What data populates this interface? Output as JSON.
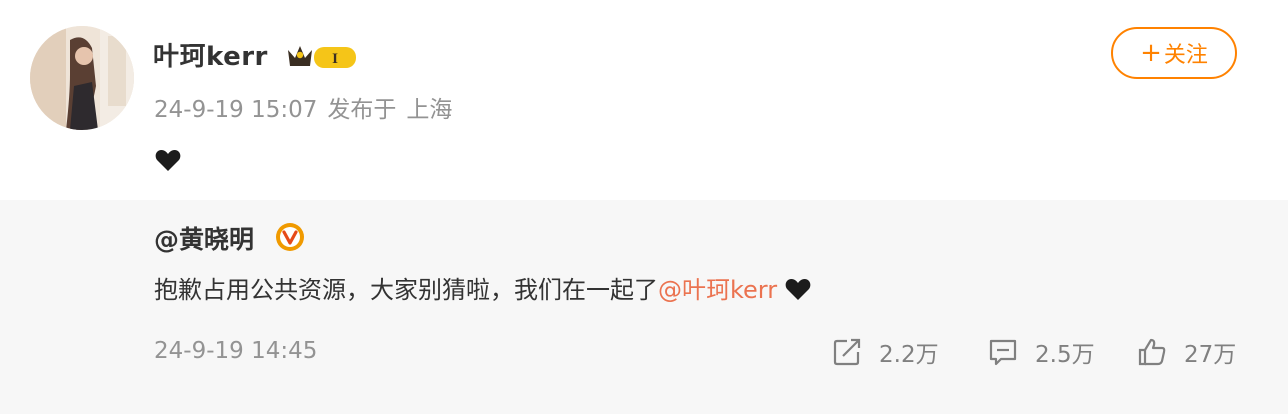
{
  "post": {
    "username": "叶珂kerr",
    "timestamp": "24-9-19 15:07",
    "location_prefix": "发布于",
    "location": "上海",
    "content_icon": "heart-icon",
    "follow_label": "关注",
    "follow_plus": "+",
    "badge_text": "I",
    "badge_color": "#f5c518"
  },
  "repost": {
    "mention_name": "@黄晓明",
    "verified_badge_color": "#f09a00",
    "text": "抱歉占用公共资源，大家别猜啦，我们在一起了",
    "mention_link": "@叶珂kerr",
    "timestamp": "24-9-19 14:45",
    "actions": {
      "share_count": "2.2万",
      "comment_count": "2.5万",
      "like_count": "27万"
    }
  },
  "colors": {
    "accent": "#ff8200",
    "link": "#eb7350",
    "meta": "#939393",
    "repost_bg": "#f7f7f7"
  }
}
